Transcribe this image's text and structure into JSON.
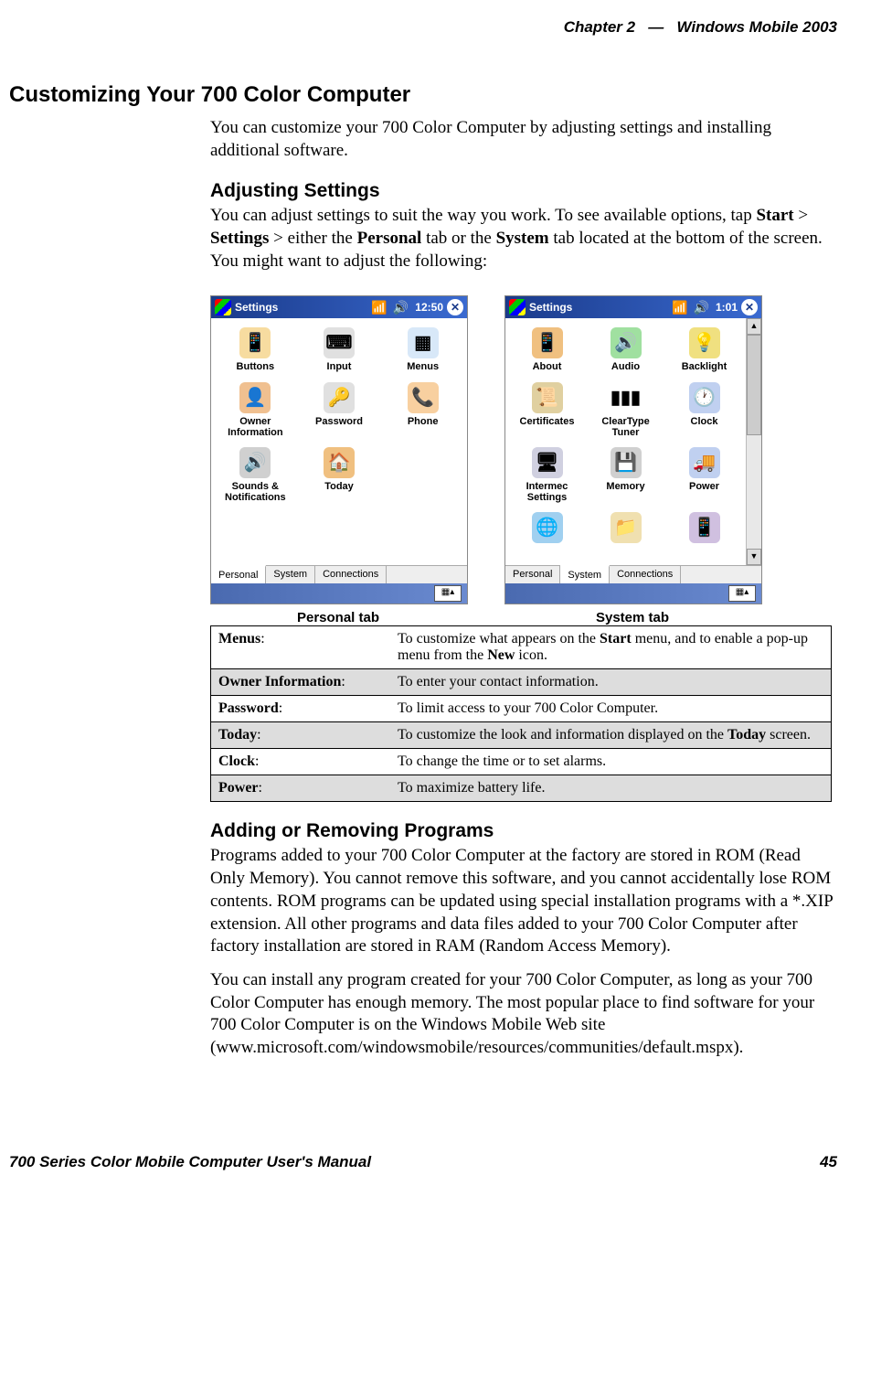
{
  "header": {
    "chapter": "Chapter 2",
    "sep": "—",
    "title": "Windows Mobile 2003"
  },
  "section": {
    "title": "Customizing Your 700 Color Computer",
    "intro": "You can customize your 700 Color Computer by adjusting settings and installing additional software."
  },
  "adjusting": {
    "heading": "Adjusting Settings",
    "text_parts": {
      "p1": "You can adjust settings to suit the way you work. To see available options, tap ",
      "b1": "Start",
      "p2": " > ",
      "b2": "Settings",
      "p3": " > either the ",
      "b3": "Personal",
      "p4": " tab or the ",
      "b4": "System",
      "p5": " tab located at the bottom of the screen. You might want to adjust the following:"
    }
  },
  "pda_personal": {
    "title": "Settings",
    "time": "12:50",
    "close": "✕",
    "icons": [
      {
        "label": "Buttons",
        "char": "📱",
        "bg": "#f7dca0"
      },
      {
        "label": "Input",
        "char": "⌨",
        "bg": "#e0e0e0"
      },
      {
        "label": "Menus",
        "char": "▦",
        "bg": "#d8e8f8"
      },
      {
        "label": "Owner Information",
        "char": "👤",
        "bg": "#f0c090"
      },
      {
        "label": "Password",
        "char": "🔑",
        "bg": "#e0e0e0"
      },
      {
        "label": "Phone",
        "char": "📞",
        "bg": "#f8d0a0"
      },
      {
        "label": "Sounds & Notifications",
        "char": "🔊",
        "bg": "#d0d0d0"
      },
      {
        "label": "Today",
        "char": "🏠",
        "bg": "#f0c080"
      }
    ],
    "tabs": [
      "Personal",
      "System",
      "Connections"
    ],
    "active_tab": 0,
    "caption_bold": "Personal",
    "caption_rest": " tab"
  },
  "pda_system": {
    "title": "Settings",
    "time": "1:01",
    "close": "✕",
    "icons": [
      {
        "label": "About",
        "char": "📱",
        "bg": "#f0c080"
      },
      {
        "label": "Audio",
        "char": "🔊",
        "bg": "#a0e0a0"
      },
      {
        "label": "Backlight",
        "char": "💡",
        "bg": "#f0e080"
      },
      {
        "label": "Certificates",
        "char": "📜",
        "bg": "#e0d0a0"
      },
      {
        "label": "ClearType Tuner",
        "char": "▮▮▮",
        "bg": "#fff"
      },
      {
        "label": "Clock",
        "char": "🕐",
        "bg": "#c0d0f0"
      },
      {
        "label": "Intermec Settings",
        "char": "🖥",
        "bg": "#d0d0e0"
      },
      {
        "label": "Memory",
        "char": "💾",
        "bg": "#d0d0d0"
      },
      {
        "label": "Power",
        "char": "🚚",
        "bg": "#c0d0f0"
      },
      {
        "label": "",
        "char": "🌐",
        "bg": "#a0d0f0"
      },
      {
        "label": "",
        "char": "📁",
        "bg": "#f0e0b0"
      },
      {
        "label": "",
        "char": "📱",
        "bg": "#d0c0e0"
      }
    ],
    "tabs": [
      "Personal",
      "System",
      "Connections"
    ],
    "active_tab": 1,
    "caption_bold": "System",
    "caption_rest": " tab"
  },
  "settings_rows": [
    {
      "label": "Menus",
      "desc_parts": [
        "To customize what appears on the ",
        "Start",
        " menu, and to enable a pop-up menu from the ",
        "New",
        " icon."
      ],
      "shaded": false
    },
    {
      "label": "Owner Information",
      "desc_parts": [
        "To enter your contact information."
      ],
      "shaded": true
    },
    {
      "label": "Password",
      "desc_parts": [
        "To limit access to your 700 Color Computer."
      ],
      "shaded": false
    },
    {
      "label": "Today",
      "desc_parts": [
        "To customize the look and information displayed on the ",
        "Today",
        " screen."
      ],
      "shaded": true
    },
    {
      "label": "Clock",
      "desc_parts": [
        "To change the time or to set alarms."
      ],
      "shaded": false
    },
    {
      "label": "Power",
      "desc_parts": [
        "To maximize battery life."
      ],
      "shaded": true
    }
  ],
  "adding": {
    "heading": "Adding or Removing Programs",
    "p1": "Programs added to your 700 Color Computer at the factory are stored in ROM (Read Only Memory). You cannot remove this software, and you cannot accidentally lose ROM contents. ROM programs can be updated using special installation programs with a *.XIP extension. All other programs and data files added to your 700 Color Computer after factory installation are stored in RAM (Random Access Memory).",
    "p2": "You can install any program created for your 700 Color Computer, as long as your 700 Color Computer has enough memory. The most popular place to find software for your 700 Color Computer is on the Windows Mobile Web site (www.microsoft.com/windowsmobile/resources/communities/default.mspx)."
  },
  "footer": {
    "left": "700 Series Color Mobile Computer User's Manual",
    "right": "45"
  }
}
